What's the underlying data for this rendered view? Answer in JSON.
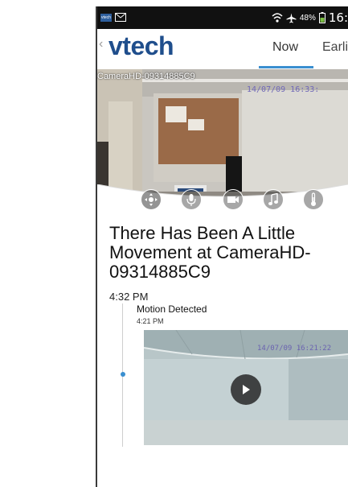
{
  "status_bar": {
    "app_badge": "vtech",
    "battery_percent": "48%",
    "time": "16:"
  },
  "app_bar": {
    "logo": "vtech",
    "tabs": [
      {
        "label": "Now",
        "selected": true
      },
      {
        "label": "Earli",
        "selected": false
      }
    ]
  },
  "camera": {
    "name": "CameraHD-09314885C9",
    "timestamp": "14/07/09 16:33:",
    "controls": [
      "pan-tilt-icon",
      "microphone-icon",
      "video-camera-icon",
      "music-note-icon",
      "thermometer-icon"
    ]
  },
  "alert": {
    "headline": "There Has Been A Little Movement at CameraHD-09314885C9",
    "time": "4:32 PM"
  },
  "event": {
    "title": "Motion Detected",
    "time": "4:21 PM",
    "clip_timestamp": "14/07/09 16:21:22"
  },
  "colors": {
    "brand": "#1f4e8c",
    "accent": "#3a8fd0",
    "status_bar": "#111111"
  }
}
